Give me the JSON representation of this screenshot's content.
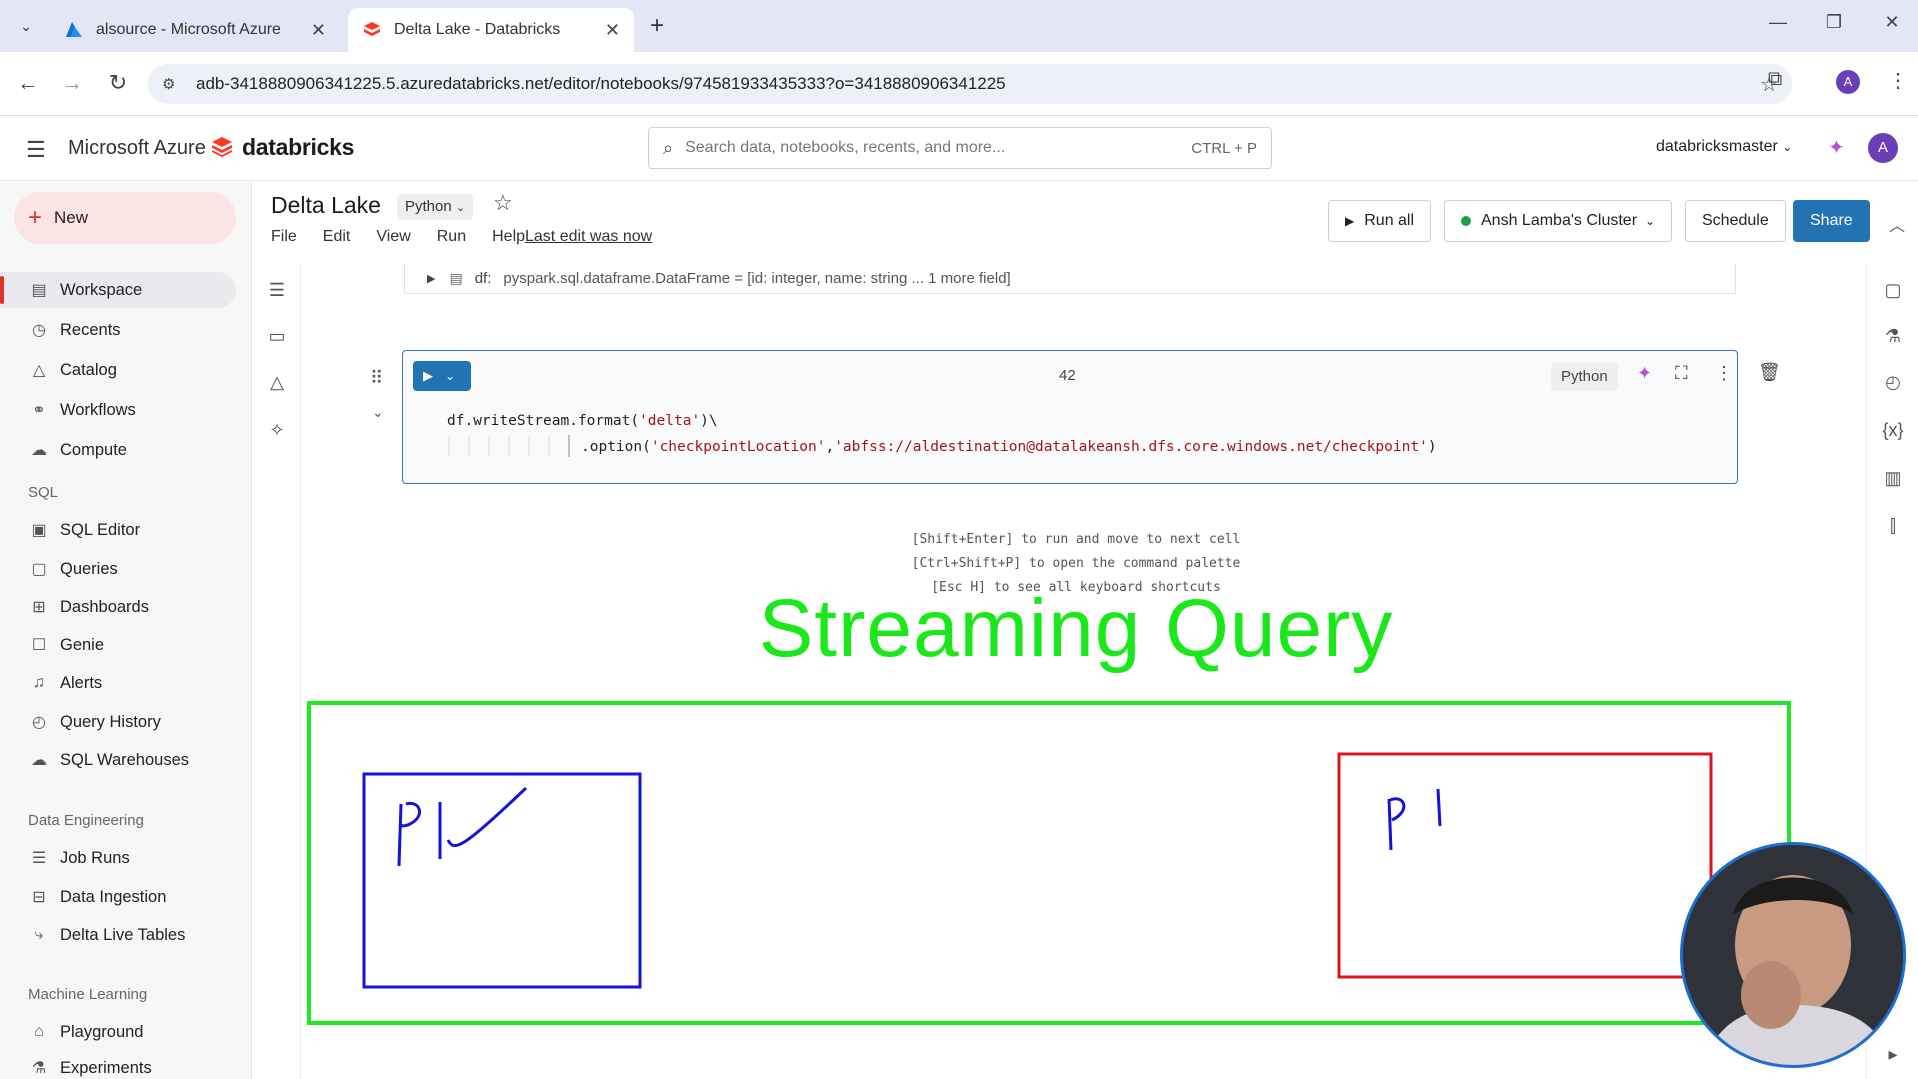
{
  "browser": {
    "tabs": [
      {
        "label": "alsource - Microsoft Azure",
        "active": false
      },
      {
        "label": "Delta Lake - Databricks",
        "active": true
      }
    ],
    "url": "adb-3418880906341225.5.azuredatabricks.net/editor/notebooks/974581933435333?o=3418880906341225",
    "profile_initial": "A"
  },
  "header": {
    "brand": "Microsoft Azure",
    "product": "databricks",
    "search_placeholder": "Search data, notebooks, recents, and more...",
    "search_shortcut": "CTRL + P",
    "workspace": "databricksmaster",
    "avatar_initial": "A"
  },
  "sidebar": {
    "new_label": "New",
    "items": [
      {
        "label": "Workspace",
        "icon": "workspace-icon",
        "selected": true
      },
      {
        "label": "Recents",
        "icon": "clock-icon"
      },
      {
        "label": "Catalog",
        "icon": "catalog-icon"
      },
      {
        "label": "Workflows",
        "icon": "workflows-icon"
      },
      {
        "label": "Compute",
        "icon": "cloud-icon"
      }
    ],
    "sql_section": "SQL",
    "sql_items": [
      {
        "label": "SQL Editor",
        "icon": "sql-editor-icon"
      },
      {
        "label": "Queries",
        "icon": "queries-icon"
      },
      {
        "label": "Dashboards",
        "icon": "dashboards-icon"
      },
      {
        "label": "Genie",
        "icon": "genie-icon"
      },
      {
        "label": "Alerts",
        "icon": "bell-icon"
      },
      {
        "label": "Query History",
        "icon": "history-icon"
      },
      {
        "label": "SQL Warehouses",
        "icon": "warehouse-icon"
      }
    ],
    "de_section": "Data Engineering",
    "de_items": [
      {
        "label": "Job Runs",
        "icon": "job-runs-icon"
      },
      {
        "label": "Data Ingestion",
        "icon": "ingestion-icon"
      },
      {
        "label": "Delta Live Tables",
        "icon": "pipeline-icon"
      }
    ],
    "ml_section": "Machine Learning",
    "ml_items": [
      {
        "label": "Playground",
        "icon": "playground-icon"
      },
      {
        "label": "Experiments",
        "icon": "experiments-icon"
      }
    ]
  },
  "notebook": {
    "title": "Delta Lake",
    "language": "Python",
    "menu": [
      "File",
      "Edit",
      "View",
      "Run",
      "Help"
    ],
    "last_edit": "Last edit was now",
    "run_all": "Run all",
    "cluster": "Ansh Lamba's Cluster",
    "schedule": "Schedule",
    "share": "Share"
  },
  "output": {
    "df_name": "df:",
    "df_type": "pyspark.sql.dataframe.DataFrame = [id: integer, name: string ... 1 more field]"
  },
  "cell": {
    "number": "42",
    "language": "Python",
    "line1_prefix": "df.writeStream.format(",
    "line1_str": "'delta'",
    "line1_suffix": ")\\",
    "line2_prefix": ".option(",
    "line2_str1": "'checkpointLocation'",
    "line2_sep": ",",
    "line2_str2": "'abfss://aldestination@datalakeansh.dfs.core.windows.net/checkpoint'",
    "line2_suffix": ")"
  },
  "hints": [
    "[Shift+Enter] to run and move to next cell",
    "[Ctrl+Shift+P] to open the command palette",
    "[Esc H] to see all keyboard shortcuts"
  ],
  "annotation": {
    "title": "Streaming Query",
    "left_box_text": "Pl",
    "right_box_text": "pl",
    "colors": {
      "title": "#1be81b",
      "outer": "#22e822",
      "left_box": "#1414d8",
      "right_box": "#e0141e"
    }
  }
}
